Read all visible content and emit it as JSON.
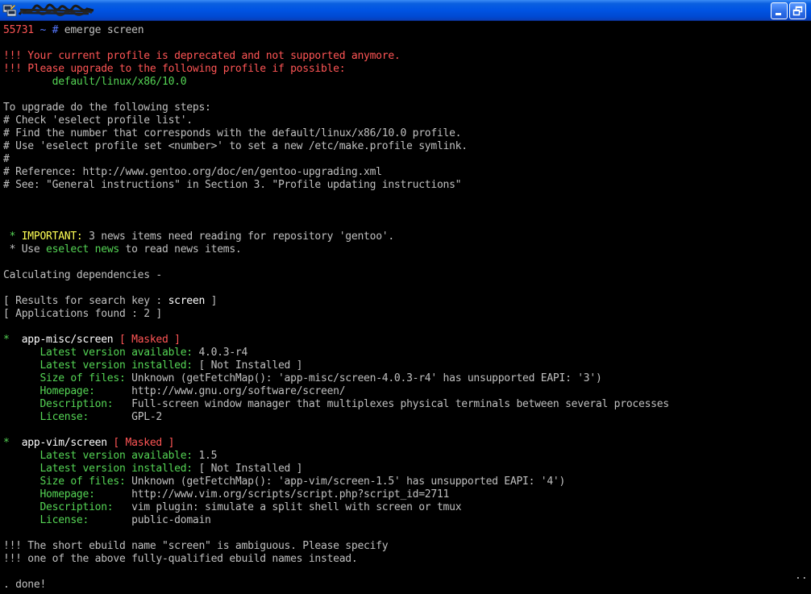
{
  "window": {
    "title": "",
    "icon": "putty-icon",
    "minimize_icon": "minimize-icon",
    "restore_icon": "restore-icon",
    "chrome_color": "#0054e3"
  },
  "terminal": {
    "colors": {
      "background": "#000000",
      "text": "#c0c0c0",
      "red": "#ff5555",
      "green": "#55d555",
      "blue": "#5577ff",
      "yellow": "#ffff55"
    },
    "prompt": {
      "host": "55731",
      "path": "~",
      "symbol": "#",
      "command": "emerge screen"
    },
    "deprecation": {
      "line1": "!!! Your current profile is deprecated and not supported anymore.",
      "line2": "!!! Please upgrade to the following profile if possible:",
      "profile": "        default/linux/x86/10.0"
    },
    "steps": [
      "To upgrade do the following steps:",
      "# Check 'eselect profile list'.",
      "# Find the number that corresponds with the default/linux/x86/10.0 profile.",
      "# Use 'eselect profile set <number>' to set a new /etc/make.profile symlink.",
      "#",
      "# Reference: http://www.gentoo.org/doc/en/gentoo-upgrading.xml",
      "# See: \"General instructions\" in Section 3. \"Profile updating instructions\""
    ],
    "news": {
      "star": " * ",
      "important": "IMPORTANT:",
      "important_text": " 3 news items need reading for repository 'gentoo'.",
      "use_prefix": " * Use ",
      "use_command": "eselect news",
      "use_suffix": " to read news items."
    },
    "calculating": "Calculating dependencies -",
    "results": {
      "search_prefix": "[ Results for search key : ",
      "search_key": "screen",
      "search_suffix": " ]",
      "apps_found": "[ Applications found : 2 ]"
    },
    "packages": [
      {
        "star": "*  ",
        "name": "app-misc/screen",
        "masked": " [ Masked ]",
        "fields": [
          {
            "label": "      Latest version available: ",
            "value": "4.0.3-r4"
          },
          {
            "label": "      Latest version installed: ",
            "value": "[ Not Installed ]"
          },
          {
            "label": "      Size of files: ",
            "value": "Unknown (getFetchMap(): 'app-misc/screen-4.0.3-r4' has unsupported EAPI: '3')"
          },
          {
            "label": "      Homepage:      ",
            "value": "http://www.gnu.org/software/screen/"
          },
          {
            "label": "      Description:   ",
            "value": "Full-screen window manager that multiplexes physical terminals between several processes"
          },
          {
            "label": "      License:       ",
            "value": "GPL-2"
          }
        ]
      },
      {
        "star": "*  ",
        "name": "app-vim/screen",
        "masked": " [ Masked ]",
        "fields": [
          {
            "label": "      Latest version available: ",
            "value": "1.5"
          },
          {
            "label": "      Latest version installed: ",
            "value": "[ Not Installed ]"
          },
          {
            "label": "      Size of files: ",
            "value": "Unknown (getFetchMap(): 'app-vim/screen-1.5' has unsupported EAPI: '4')"
          },
          {
            "label": "      Homepage:      ",
            "value": "http://www.vim.org/scripts/script.php?script_id=2711"
          },
          {
            "label": "      Description:   ",
            "value": "vim plugin: simulate a split shell with screen or tmux"
          },
          {
            "label": "      License:       ",
            "value": "public-domain"
          }
        ]
      }
    ],
    "ambiguous": [
      "!!! The short ebuild name \"screen\" is ambiguous. Please specify",
      "!!! one of the above fully-qualified ebuild names instead."
    ],
    "continuation": "..",
    "done": ". done!"
  }
}
